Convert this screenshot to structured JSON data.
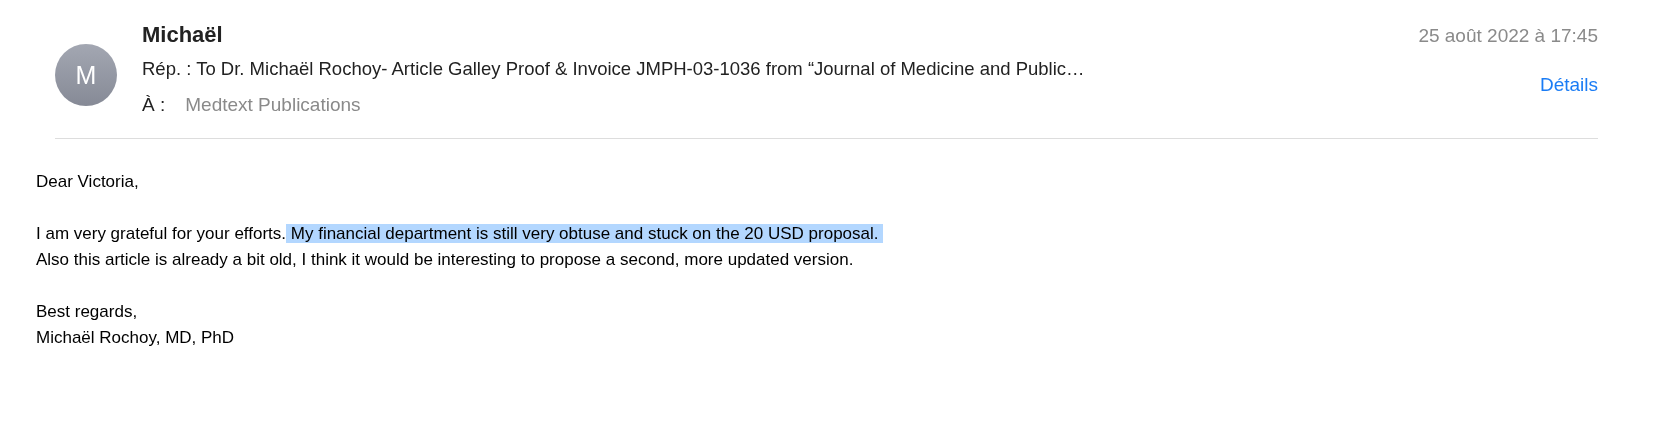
{
  "header": {
    "avatar_initial": "M",
    "sender": "Michaël",
    "date": "25 août 2022 à 17:45",
    "subject": "Rép. : To Dr. Michaël Rochoy- Article Galley Proof & Invoice JMPH-03-1036 from “Journal of Medicine and Public…",
    "to_label": "À :",
    "to": "Medtext Publications",
    "details_link": "Détails"
  },
  "body": [
    {
      "lines": [
        [
          {
            "text": "Dear Victoria,",
            "selected": false
          }
        ]
      ]
    },
    {
      "lines": [
        [
          {
            "text": "I am very grateful for your efforts.",
            "selected": false
          },
          {
            "text": " My financial department is still very obtuse and stuck on the 20 USD proposal. ",
            "selected": true
          }
        ],
        [
          {
            "text": "Also this article is already a bit old, I think it would be interesting to propose a second, more updated version.",
            "selected": false
          }
        ]
      ]
    },
    {
      "lines": [
        [
          {
            "text": "Best regards,",
            "selected": false
          }
        ],
        [
          {
            "text": "Michaël Rochoy, MD, PhD",
            "selected": false
          }
        ]
      ]
    }
  ]
}
